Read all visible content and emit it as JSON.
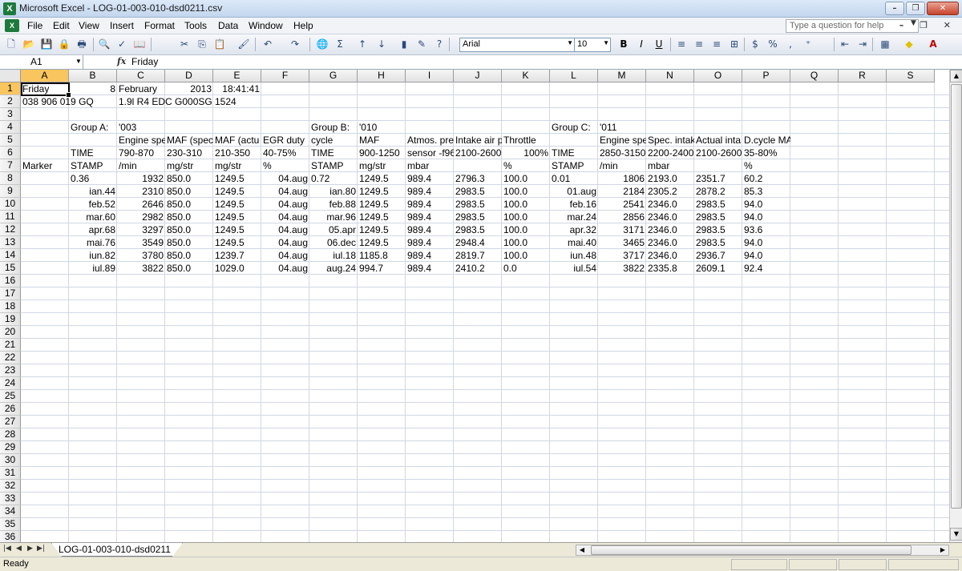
{
  "window": {
    "title": "Microsoft Excel - LOG-01-003-010-dsd0211.csv"
  },
  "menu": [
    "File",
    "Edit",
    "View",
    "Insert",
    "Format",
    "Tools",
    "Data",
    "Window",
    "Help"
  ],
  "help_placeholder": "Type a question for help",
  "toolbar": {
    "font": "Arial",
    "size": "10"
  },
  "formula_bar": {
    "name_box": "A1",
    "fx": "fx",
    "value": "Friday"
  },
  "columns": [
    "A",
    "B",
    "C",
    "D",
    "E",
    "F",
    "G",
    "H",
    "I",
    "J",
    "K",
    "L",
    "M",
    "N",
    "O",
    "P",
    "Q",
    "R",
    "S"
  ],
  "row_count": 36,
  "selected_cell": "A1",
  "rows": [
    {
      "row": 1,
      "cells": [
        [
          "A",
          "Friday",
          ""
        ],
        [
          "B",
          "8",
          "r"
        ],
        [
          "C",
          "February",
          ""
        ],
        [
          "D",
          "2013",
          "r"
        ],
        [
          "E",
          "18:41:41",
          "r"
        ]
      ]
    },
    {
      "row": 2,
      "cells": [
        [
          "A",
          "038 906 019 GQ",
          ""
        ],
        [
          "C",
          "1.9l R4 EDC G000SG",
          ""
        ],
        [
          "E",
          "1524",
          ""
        ]
      ]
    },
    {
      "row": 4,
      "cells": [
        [
          "B",
          "Group A:",
          ""
        ],
        [
          "C",
          "'003",
          ""
        ],
        [
          "G",
          "Group B:",
          ""
        ],
        [
          "H",
          "'010",
          ""
        ],
        [
          "L",
          "Group C:",
          ""
        ],
        [
          "M",
          "'011",
          ""
        ]
      ]
    },
    {
      "row": 5,
      "cells": [
        [
          "C",
          "Engine spe",
          ""
        ],
        [
          "D",
          "MAF (spec",
          ""
        ],
        [
          "E",
          "MAF (actu",
          ""
        ],
        [
          "F",
          "EGR duty",
          ""
        ],
        [
          "G",
          "cycle",
          ""
        ],
        [
          "H",
          "MAF",
          ""
        ],
        [
          "I",
          "Atmos. pre",
          ""
        ],
        [
          "J",
          "Intake air p",
          ""
        ],
        [
          "K",
          "Throttle",
          ""
        ],
        [
          "M",
          "Engine spe",
          ""
        ],
        [
          "N",
          "Spec. intak",
          ""
        ],
        [
          "O",
          "Actual inta",
          ""
        ],
        [
          "P",
          "D.cycle MAP",
          ""
        ]
      ]
    },
    {
      "row": 6,
      "cells": [
        [
          "B",
          "TIME",
          ""
        ],
        [
          "C",
          "790-870",
          ""
        ],
        [
          "D",
          "230-310",
          ""
        ],
        [
          "E",
          "210-350",
          ""
        ],
        [
          "F",
          "40-75%",
          ""
        ],
        [
          "G",
          "TIME",
          ""
        ],
        [
          "H",
          "900-1250",
          ""
        ],
        [
          "I",
          "sensor -f96",
          ""
        ],
        [
          "J",
          "2100-2600",
          ""
        ],
        [
          "K",
          "100%",
          "r"
        ],
        [
          "L",
          "TIME",
          ""
        ],
        [
          "M",
          "2850-3150",
          ""
        ],
        [
          "N",
          "2200-2400",
          ""
        ],
        [
          "O",
          "2100-2600",
          ""
        ],
        [
          "P",
          "35-80%",
          ""
        ]
      ]
    },
    {
      "row": 7,
      "cells": [
        [
          "A",
          "Marker",
          ""
        ],
        [
          "B",
          "STAMP",
          ""
        ],
        [
          "C",
          "/min",
          ""
        ],
        [
          "D",
          "mg/str",
          ""
        ],
        [
          "E",
          "mg/str",
          ""
        ],
        [
          "F",
          "%",
          ""
        ],
        [
          "G",
          "STAMP",
          ""
        ],
        [
          "H",
          "mg/str",
          ""
        ],
        [
          "I",
          "mbar",
          ""
        ],
        [
          "K",
          "%",
          ""
        ],
        [
          "L",
          "STAMP",
          ""
        ],
        [
          "M",
          "/min",
          ""
        ],
        [
          "N",
          "mbar",
          ""
        ],
        [
          "P",
          "%",
          ""
        ]
      ]
    },
    {
      "row": 8,
      "cells": [
        [
          "B",
          "0.36",
          ""
        ],
        [
          "C",
          "1932",
          "r"
        ],
        [
          "D",
          "850.0",
          ""
        ],
        [
          "E",
          "1249.5",
          ""
        ],
        [
          "F",
          "04.aug",
          "r"
        ],
        [
          "G",
          "0.72",
          ""
        ],
        [
          "H",
          "1249.5",
          ""
        ],
        [
          "I",
          "989.4",
          ""
        ],
        [
          "J",
          "2796.3",
          ""
        ],
        [
          "K",
          "100.0",
          ""
        ],
        [
          "L",
          "0.01",
          ""
        ],
        [
          "M",
          "1806",
          "r"
        ],
        [
          "N",
          "2193.0",
          ""
        ],
        [
          "O",
          "2351.7",
          ""
        ],
        [
          "P",
          "60.2",
          ""
        ]
      ]
    },
    {
      "row": 9,
      "cells": [
        [
          "B",
          "ian.44",
          "r"
        ],
        [
          "C",
          "2310",
          "r"
        ],
        [
          "D",
          "850.0",
          ""
        ],
        [
          "E",
          "1249.5",
          ""
        ],
        [
          "F",
          "04.aug",
          "r"
        ],
        [
          "G",
          "ian.80",
          "r"
        ],
        [
          "H",
          "1249.5",
          ""
        ],
        [
          "I",
          "989.4",
          ""
        ],
        [
          "J",
          "2983.5",
          ""
        ],
        [
          "K",
          "100.0",
          ""
        ],
        [
          "L",
          "01.aug",
          "r"
        ],
        [
          "M",
          "2184",
          "r"
        ],
        [
          "N",
          "2305.2",
          ""
        ],
        [
          "O",
          "2878.2",
          ""
        ],
        [
          "P",
          "85.3",
          ""
        ]
      ]
    },
    {
      "row": 10,
      "cells": [
        [
          "B",
          "feb.52",
          "r"
        ],
        [
          "C",
          "2646",
          "r"
        ],
        [
          "D",
          "850.0",
          ""
        ],
        [
          "E",
          "1249.5",
          ""
        ],
        [
          "F",
          "04.aug",
          "r"
        ],
        [
          "G",
          "feb.88",
          "r"
        ],
        [
          "H",
          "1249.5",
          ""
        ],
        [
          "I",
          "989.4",
          ""
        ],
        [
          "J",
          "2983.5",
          ""
        ],
        [
          "K",
          "100.0",
          ""
        ],
        [
          "L",
          "feb.16",
          "r"
        ],
        [
          "M",
          "2541",
          "r"
        ],
        [
          "N",
          "2346.0",
          ""
        ],
        [
          "O",
          "2983.5",
          ""
        ],
        [
          "P",
          "94.0",
          ""
        ]
      ]
    },
    {
      "row": 11,
      "cells": [
        [
          "B",
          "mar.60",
          "r"
        ],
        [
          "C",
          "2982",
          "r"
        ],
        [
          "D",
          "850.0",
          ""
        ],
        [
          "E",
          "1249.5",
          ""
        ],
        [
          "F",
          "04.aug",
          "r"
        ],
        [
          "G",
          "mar.96",
          "r"
        ],
        [
          "H",
          "1249.5",
          ""
        ],
        [
          "I",
          "989.4",
          ""
        ],
        [
          "J",
          "2983.5",
          ""
        ],
        [
          "K",
          "100.0",
          ""
        ],
        [
          "L",
          "mar.24",
          "r"
        ],
        [
          "M",
          "2856",
          "r"
        ],
        [
          "N",
          "2346.0",
          ""
        ],
        [
          "O",
          "2983.5",
          ""
        ],
        [
          "P",
          "94.0",
          ""
        ]
      ]
    },
    {
      "row": 12,
      "cells": [
        [
          "B",
          "apr.68",
          "r"
        ],
        [
          "C",
          "3297",
          "r"
        ],
        [
          "D",
          "850.0",
          ""
        ],
        [
          "E",
          "1249.5",
          ""
        ],
        [
          "F",
          "04.aug",
          "r"
        ],
        [
          "G",
          "05.apr",
          "r"
        ],
        [
          "H",
          "1249.5",
          ""
        ],
        [
          "I",
          "989.4",
          ""
        ],
        [
          "J",
          "2983.5",
          ""
        ],
        [
          "K",
          "100.0",
          ""
        ],
        [
          "L",
          "apr.32",
          "r"
        ],
        [
          "M",
          "3171",
          "r"
        ],
        [
          "N",
          "2346.0",
          ""
        ],
        [
          "O",
          "2983.5",
          ""
        ],
        [
          "P",
          "93.6",
          ""
        ]
      ]
    },
    {
      "row": 13,
      "cells": [
        [
          "B",
          "mai.76",
          "r"
        ],
        [
          "C",
          "3549",
          "r"
        ],
        [
          "D",
          "850.0",
          ""
        ],
        [
          "E",
          "1249.5",
          ""
        ],
        [
          "F",
          "04.aug",
          "r"
        ],
        [
          "G",
          "06.dec",
          "r"
        ],
        [
          "H",
          "1249.5",
          ""
        ],
        [
          "I",
          "989.4",
          ""
        ],
        [
          "J",
          "2948.4",
          ""
        ],
        [
          "K",
          "100.0",
          ""
        ],
        [
          "L",
          "mai.40",
          "r"
        ],
        [
          "M",
          "3465",
          "r"
        ],
        [
          "N",
          "2346.0",
          ""
        ],
        [
          "O",
          "2983.5",
          ""
        ],
        [
          "P",
          "94.0",
          ""
        ]
      ]
    },
    {
      "row": 14,
      "cells": [
        [
          "B",
          "iun.82",
          "r"
        ],
        [
          "C",
          "3780",
          "r"
        ],
        [
          "D",
          "850.0",
          ""
        ],
        [
          "E",
          "1239.7",
          ""
        ],
        [
          "F",
          "04.aug",
          "r"
        ],
        [
          "G",
          "iul.18",
          "r"
        ],
        [
          "H",
          "1185.8",
          ""
        ],
        [
          "I",
          "989.4",
          ""
        ],
        [
          "J",
          "2819.7",
          ""
        ],
        [
          "K",
          "100.0",
          ""
        ],
        [
          "L",
          "iun.48",
          "r"
        ],
        [
          "M",
          "3717",
          "r"
        ],
        [
          "N",
          "2346.0",
          ""
        ],
        [
          "O",
          "2936.7",
          ""
        ],
        [
          "P",
          "94.0",
          ""
        ]
      ]
    },
    {
      "row": 15,
      "cells": [
        [
          "B",
          "iul.89",
          "r"
        ],
        [
          "C",
          "3822",
          "r"
        ],
        [
          "D",
          "850.0",
          ""
        ],
        [
          "E",
          "1029.0",
          ""
        ],
        [
          "F",
          "04.aug",
          "r"
        ],
        [
          "G",
          "aug.24",
          "r"
        ],
        [
          "H",
          "994.7",
          ""
        ],
        [
          "I",
          "989.4",
          ""
        ],
        [
          "J",
          "2410.2",
          ""
        ],
        [
          "K",
          "0.0",
          ""
        ],
        [
          "L",
          "iul.54",
          "r"
        ],
        [
          "M",
          "3822",
          "r"
        ],
        [
          "N",
          "2335.8",
          ""
        ],
        [
          "O",
          "2609.1",
          ""
        ],
        [
          "P",
          "92.4",
          ""
        ]
      ]
    }
  ],
  "sheet_tab": "LOG-01-003-010-dsd0211",
  "status": "Ready"
}
